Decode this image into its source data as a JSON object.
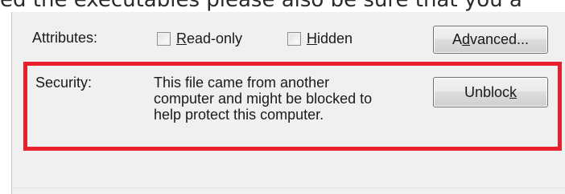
{
  "caption": "ed the executables please also be sure that you a",
  "attributes": {
    "label": "Attributes:",
    "readonly": {
      "label_prefix": "",
      "mnemonic": "R",
      "label_rest": "ead-only",
      "checked": false
    },
    "hidden": {
      "label_prefix": "",
      "mnemonic": "H",
      "label_rest": "idden",
      "checked": false
    },
    "advanced_button": {
      "prefix": "A",
      "mnemonic": "d",
      "rest": "vanced..."
    }
  },
  "security": {
    "label": "Security:",
    "message_lines": [
      "This file came from another",
      "computer and might be blocked to",
      "help protect this computer."
    ],
    "unblock_button": {
      "prefix": "Unbloc",
      "mnemonic": "k",
      "rest": ""
    },
    "highlight_color": "#e8202d"
  }
}
